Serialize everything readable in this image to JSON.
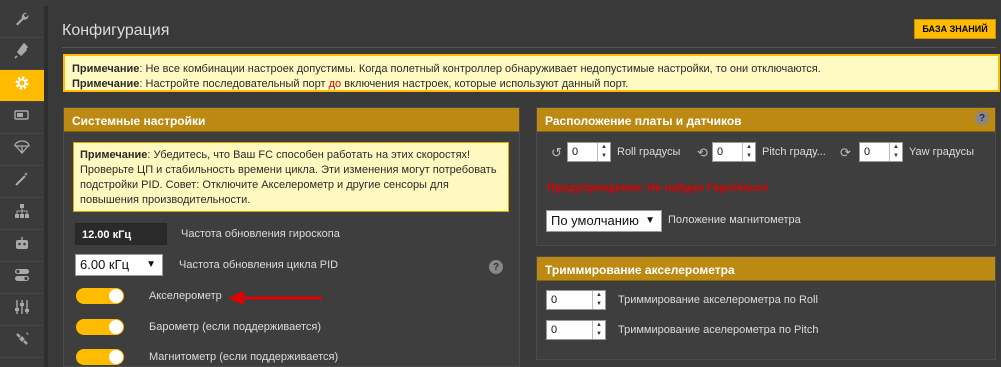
{
  "sidebar": {
    "items": [
      {
        "icon": "wrench-icon"
      },
      {
        "icon": "plug-icon"
      },
      {
        "icon": "gear-icon",
        "active": true
      },
      {
        "icon": "battery-icon"
      },
      {
        "icon": "parachute-icon"
      },
      {
        "icon": "magic-wand-icon"
      },
      {
        "icon": "network-icon"
      },
      {
        "icon": "robot-icon"
      },
      {
        "icon": "switches-icon"
      },
      {
        "icon": "sliders-icon"
      },
      {
        "icon": "satellite-icon"
      }
    ]
  },
  "header": {
    "title": "Конфигурация",
    "wiki_button": "БАЗА ЗНАНИЙ"
  },
  "top_note": {
    "line1_label": "Примечание",
    "line1_text": ": Не все комбинации настроек допустимы. Когда полетный контроллер обнаруживает недопустимые настройки, то они отключаются.",
    "line2_label": "Примечание",
    "line2_pre": ": Настройте последовательный порт ",
    "line2_red": "до",
    "line2_post": " включения настроек, которые используют данный порт."
  },
  "system_panel": {
    "title": "Системные настройки",
    "note_label": "Примечание",
    "note_text": ": Убедитесь, что Ваш FC способен работать на этих скоростях! Проверьте ЦП и стабильность времени цикла. Эти изменения могут потребовать подстройки PID. Совет: Отключите Акселерометр и другие сенсоры для повышения производительности.",
    "gyro_rate_value": "12.00 кГц",
    "gyro_rate_label": "Частота обновления гироскопа",
    "pid_rate_value": "6.00 кГц",
    "pid_rate_label": "Частота обновления цикла PID",
    "help": "?",
    "toggles": [
      {
        "label": "Акселерометр",
        "on": true
      },
      {
        "label": "Барометр (если поддерживается)",
        "on": true
      },
      {
        "label": "Магнитометр (если поддерживается)",
        "on": true
      }
    ]
  },
  "board_panel": {
    "title": "Расположение платы и датчиков",
    "help": "?",
    "roll_value": "0",
    "roll_label": "Roll градусы",
    "pitch_value": "0",
    "pitch_label": "Pitch граду...",
    "yaw_value": "0",
    "yaw_label": "Yaw градусы",
    "warning": "Предупреждение: Не найден Гиро/Аксел",
    "mag_select": "По умолчанию",
    "mag_label": "Положение магнитометра"
  },
  "trim_panel": {
    "title": "Триммирование акселерометра",
    "roll_value": "0",
    "roll_label": "Триммирование акселерометра по Roll",
    "pitch_value": "0",
    "pitch_label": "Триммирование аселерометра по Pitch"
  },
  "colors": {
    "accent": "#ffbb00",
    "panel_header": "#bc8a12",
    "note_bg": "#fffac2",
    "warning": "#e00000",
    "arrow": "#e00000"
  }
}
